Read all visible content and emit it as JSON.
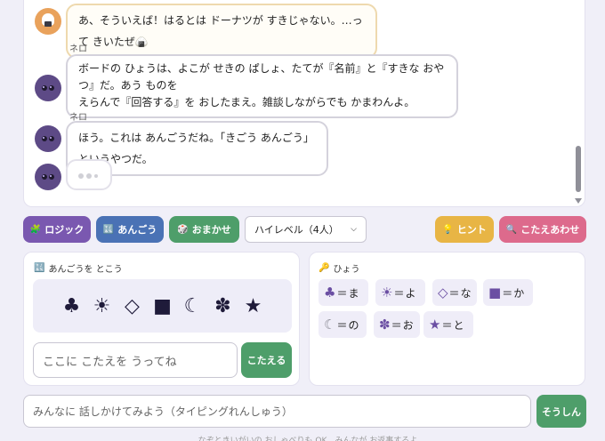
{
  "chat": {
    "messages": [
      {
        "role": "user",
        "sender": "",
        "text": "あ、そういえば！はるとは ドーナツが すきじゃない。…って きいたぜ🍙"
      },
      {
        "role": "bot",
        "sender": "ネロ",
        "line1": "ボードの ひょうは、よこが せきの ぱしょ、たてが『名前』と『すきな おやつ』だ。あう ものを",
        "line2": "えらんで『回答する』を おしたまえ。雑談しながらでも かまわんよ。"
      },
      {
        "role": "bot",
        "sender": "ネロ",
        "text": "ほう。これは あんごうだね。「きごう あんごう」というやつだ。"
      }
    ]
  },
  "toolbar": {
    "logic": {
      "icon": "🧩",
      "label": "ロジック",
      "color": "#7a58b0"
    },
    "cipher": {
      "icon": "🔣",
      "label": "あんごう",
      "color": "#4a72b5"
    },
    "random": {
      "icon": "🎲",
      "label": "おまかせ",
      "color": "#4e9e6a"
    },
    "level_select": {
      "value": "ハイレベル（4人）"
    },
    "hint": {
      "icon": "💡",
      "label": "ヒント",
      "color": "#e8b545"
    },
    "check": {
      "icon": "🔍",
      "label": "こたえあわせ",
      "color": "#dd6a8c"
    }
  },
  "cipher_card": {
    "icon": "🔣",
    "title": "あんごうを とこう",
    "symbols": [
      "♣",
      "☀",
      "◇",
      "■",
      "☾",
      "✽",
      "★"
    ],
    "input_placeholder": "ここに こたえを うってね",
    "submit_label": "こたえる"
  },
  "key_card": {
    "icon": "🔑",
    "title": "ひょう",
    "entries": [
      {
        "symbol": "♣",
        "eq": "＝",
        "kana": "ま",
        "color": "#6b4fa3"
      },
      {
        "symbol": "☀",
        "eq": "＝",
        "kana": "よ",
        "color": "#6b4fa3"
      },
      {
        "symbol": "◇",
        "eq": "＝",
        "kana": "な",
        "color": "#6b4fa3"
      },
      {
        "symbol": "■",
        "eq": "＝",
        "kana": "か",
        "color": "#6b4fa3"
      },
      {
        "symbol": "☾",
        "eq": "＝",
        "kana": "の",
        "color": "#8a8a94"
      },
      {
        "symbol": "✽",
        "eq": "＝",
        "kana": "お",
        "color": "#6b4fa3"
      },
      {
        "symbol": "★",
        "eq": "＝",
        "kana": "と",
        "color": "#6b4fa3"
      }
    ]
  },
  "footer": {
    "chat_placeholder": "みんなに 話しかけてみよう（タイピングれんしゅう）",
    "send_label": "そうしん",
    "note": "… なぞときいがいの おしゃべりも OK。みんなが お返事するよ"
  }
}
